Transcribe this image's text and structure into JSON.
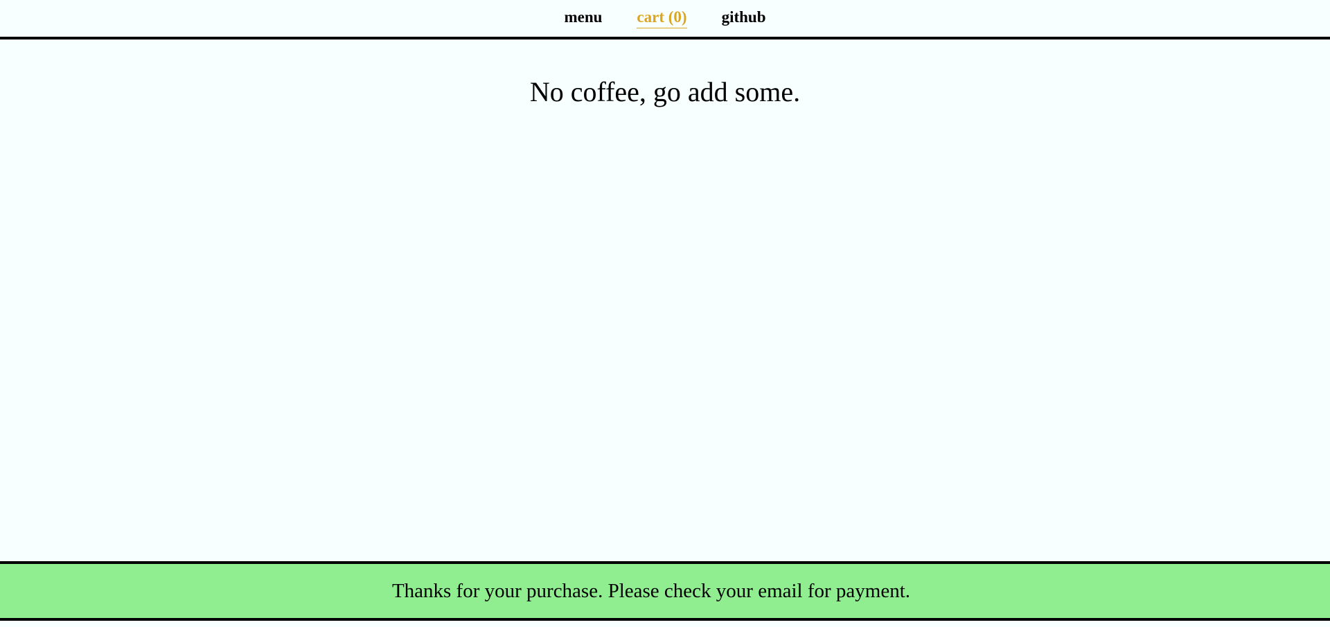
{
  "nav": {
    "items": [
      {
        "label": "menu",
        "active": false
      },
      {
        "label": "cart (0)",
        "active": true
      },
      {
        "label": "github",
        "active": false
      }
    ]
  },
  "main": {
    "empty_message": "No coffee, go add some."
  },
  "banner": {
    "message": "Thanks for your purchase. Please check your email for payment."
  },
  "colors": {
    "background": "#f8ffff",
    "active_link": "#daa520",
    "banner": "#90ee90",
    "border": "#000000"
  }
}
